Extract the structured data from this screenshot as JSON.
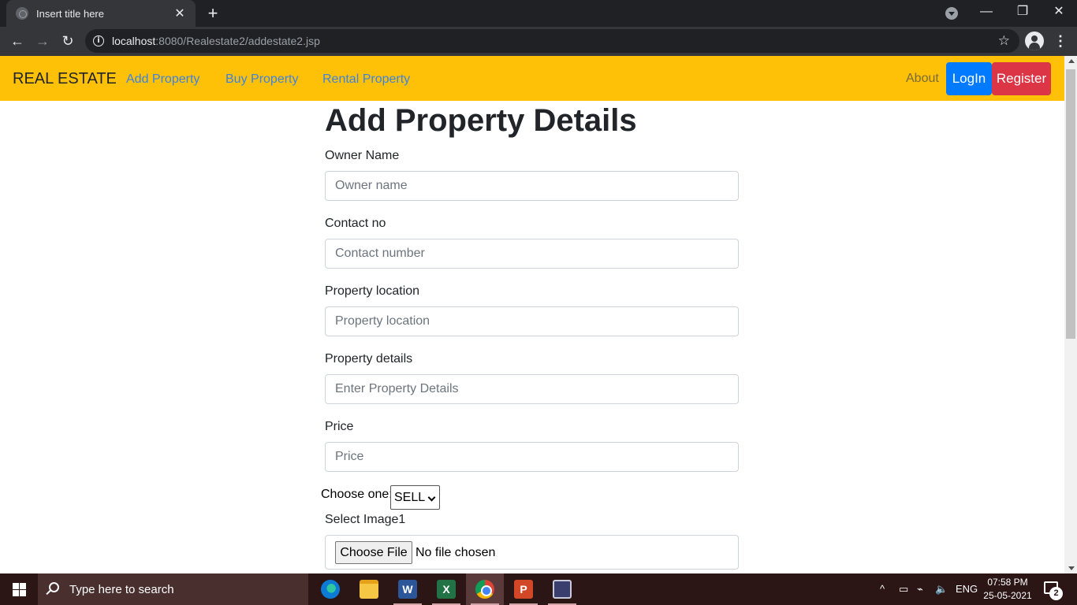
{
  "browser": {
    "tab_title": "Insert title here",
    "tab_close": "✕",
    "new_tab": "+",
    "url_host": "localhost",
    "url_path": ":8080/Realestate2/addestate2.jsp",
    "window_controls": {
      "minimize": "—",
      "restore": "❐",
      "close": "✕"
    },
    "back": "←",
    "forward": "→",
    "reload": "↻",
    "star": "☆",
    "info": "i",
    "menu": "⋮"
  },
  "navbar": {
    "brand": "REAL ESTATE",
    "links": [
      "Add Property",
      "Buy Property",
      "Rental Property"
    ],
    "about": "About",
    "login": "LogIn",
    "register": "Register",
    "bg_color": "#ffc107"
  },
  "form": {
    "title": "Add Property Details",
    "fields": [
      {
        "label": "Owner Name",
        "placeholder": "Owner name"
      },
      {
        "label": "Contact no",
        "placeholder": "Contact number"
      },
      {
        "label": "Property location",
        "placeholder": "Property location"
      },
      {
        "label": "Property details",
        "placeholder": "Enter Property Details"
      },
      {
        "label": "Price",
        "placeholder": "Price"
      }
    ],
    "choose_label": "Choose one:",
    "choose_value": "SELL",
    "image_label": "Select Image1",
    "file_button": "Choose File",
    "file_status": "No file chosen"
  },
  "taskbar": {
    "search_placeholder": "Type here to search",
    "apps": [
      "edge-icon",
      "file-explorer-icon",
      "word-icon",
      "excel-icon",
      "chrome-icon",
      "powerpoint-icon",
      "app-icon"
    ],
    "word_letter": "W",
    "excel_letter": "X",
    "ppt_letter": "P",
    "tray_up": "^",
    "language": "ENG",
    "time": "07:58 PM",
    "date": "25-05-2021",
    "notifications": "2"
  }
}
